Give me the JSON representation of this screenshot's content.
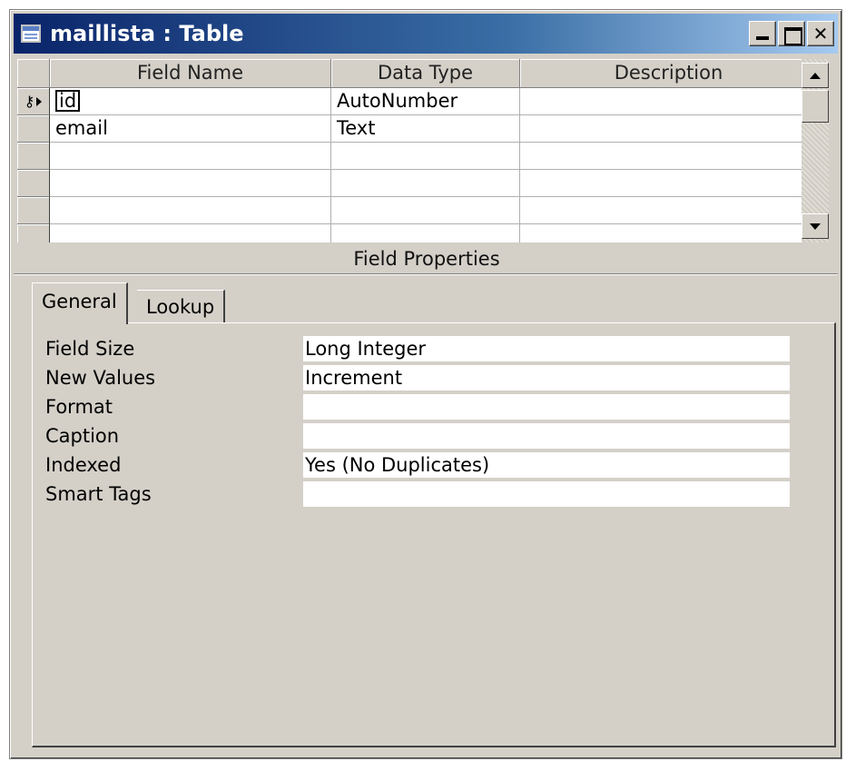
{
  "window": {
    "title": "maillista : Table"
  },
  "grid": {
    "columns": [
      "Field Name",
      "Data Type",
      "Description"
    ],
    "rows": [
      {
        "field_name": "id",
        "data_type": "AutoNumber",
        "description": ""
      },
      {
        "field_name": "email",
        "data_type": "Text",
        "description": ""
      }
    ]
  },
  "field_properties": {
    "label": "Field Properties",
    "tabs": [
      "General",
      "Lookup"
    ],
    "active_tab": "General",
    "properties": [
      {
        "label": "Field Size",
        "value": "Long Integer"
      },
      {
        "label": "New Values",
        "value": "Increment"
      },
      {
        "label": "Format",
        "value": ""
      },
      {
        "label": "Caption",
        "value": ""
      },
      {
        "label": "Indexed",
        "value": "Yes (No Duplicates)"
      },
      {
        "label": "Smart Tags",
        "value": ""
      }
    ]
  },
  "colors": {
    "title_start": "#0a246a",
    "title_end": "#a6caf0",
    "face": "#d4d0c8"
  },
  "icons": [
    "table-icon",
    "minimize-icon",
    "maximize-icon",
    "close-icon",
    "primary-key-icon",
    "current-row-arrow-icon",
    "scroll-up-icon",
    "scroll-down-icon"
  ]
}
